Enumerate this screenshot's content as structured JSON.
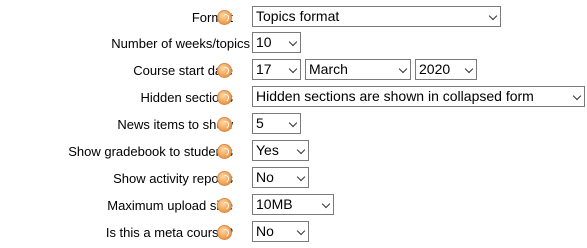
{
  "rows": [
    {
      "label": "Format",
      "help": true,
      "selects": [
        {
          "value": "Topics format"
        }
      ]
    },
    {
      "label": "Number of weeks/topics",
      "help": false,
      "selects": [
        {
          "value": "10"
        }
      ]
    },
    {
      "label": "Course start date",
      "help": true,
      "selects": [
        {
          "value": "17"
        },
        {
          "value": "March"
        },
        {
          "value": "2020"
        }
      ]
    },
    {
      "label": "Hidden sections",
      "help": true,
      "selects": [
        {
          "value": "Hidden sections are shown in collapsed form"
        }
      ]
    },
    {
      "label": "News items to show",
      "help": true,
      "selects": [
        {
          "value": "5"
        }
      ]
    },
    {
      "label": "Show gradebook to students",
      "help": true,
      "selects": [
        {
          "value": "Yes"
        }
      ]
    },
    {
      "label": "Show activity reports",
      "help": true,
      "selects": [
        {
          "value": "No"
        }
      ]
    },
    {
      "label": "Maximum upload size",
      "help": true,
      "selects": [
        {
          "value": "10MB"
        }
      ]
    },
    {
      "label": "Is this a meta course?",
      "help": true,
      "selects": [
        {
          "value": "No"
        }
      ]
    }
  ],
  "colors": {
    "help_icon": "#f2a65a",
    "select_border": "#7a7a7a"
  }
}
